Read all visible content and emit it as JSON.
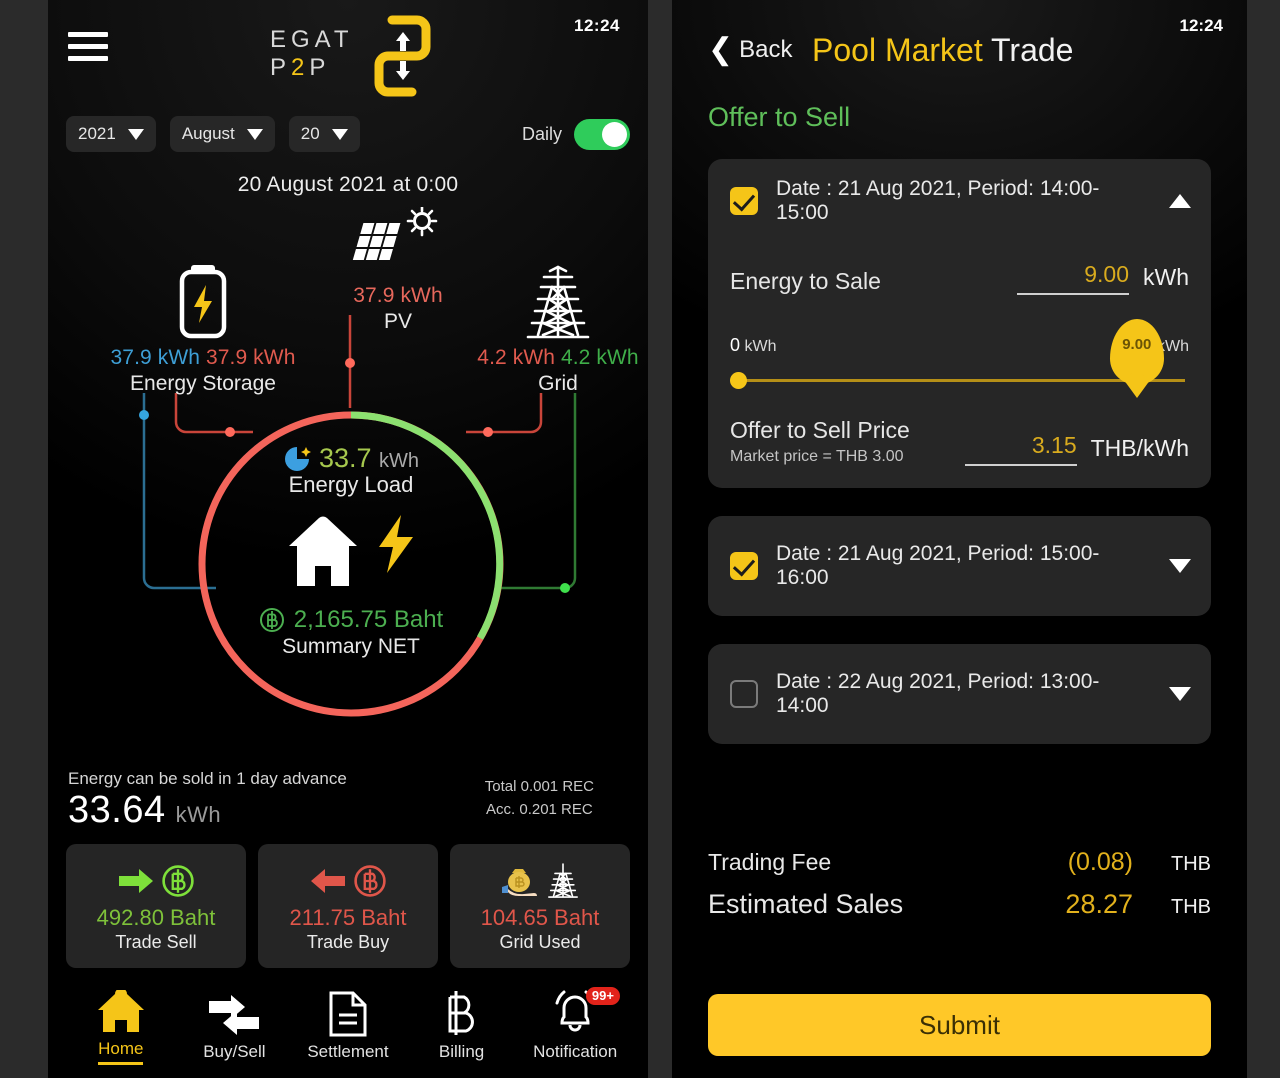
{
  "left": {
    "time": "12:24",
    "logo": {
      "line1": "EGAT",
      "p": "P",
      "two": "2",
      "p2": "P"
    },
    "selectors": [
      {
        "name": "year",
        "value": "2021"
      },
      {
        "name": "month",
        "value": "August"
      },
      {
        "name": "day",
        "value": "20"
      }
    ],
    "toggle": {
      "label": "Daily",
      "state": "on"
    },
    "date_line": "20 August 2021 at 0:00",
    "nodes": {
      "pv": {
        "value": "37.9 kWh",
        "label": "PV"
      },
      "storage": {
        "value_in": "37.9 kWh",
        "value_out": "37.9 kWh",
        "label": "Energy Storage"
      },
      "grid": {
        "value_in": "4.2 kWh",
        "value_out": "4.2 kWh",
        "label": "Grid"
      }
    },
    "center": {
      "load_value": "33.7",
      "load_unit": "kWh",
      "load_label": "Energy Load",
      "net_value": "2,165.75 Baht",
      "net_label": "Summary NET"
    },
    "sellable": {
      "caption": "Energy can be sold in 1 day advance",
      "value": "33.64",
      "unit": "kWh",
      "rec_total": "Total 0.001 REC",
      "rec_acc": "Acc. 0.201 REC"
    },
    "trade_cards": [
      {
        "name": "trade-sell",
        "amount": "492.80 Baht",
        "caption": "Trade Sell",
        "color": "#7ec13a"
      },
      {
        "name": "trade-buy",
        "amount": "211.75 Baht",
        "caption": "Trade Buy",
        "color": "#e0564a"
      },
      {
        "name": "grid-used",
        "amount": "104.65 Baht",
        "caption": "Grid Used",
        "color": "#e0564a"
      }
    ],
    "nav": [
      {
        "name": "home",
        "label": "Home",
        "active": true
      },
      {
        "name": "buy-sell",
        "label": "Buy/Sell",
        "active": false
      },
      {
        "name": "settlement",
        "label": "Settlement",
        "active": false
      },
      {
        "name": "billing",
        "label": "Billing",
        "active": false
      },
      {
        "name": "notification",
        "label": "Notification",
        "active": false,
        "badge": "99+"
      }
    ]
  },
  "right": {
    "time": "12:24",
    "back_label": "Back",
    "title_accent": "Pool Market",
    "title_rest": " Trade",
    "section_title": "Offer to Sell",
    "offers": [
      {
        "checked": true,
        "expanded": true,
        "title": "Date : 21 Aug 2021, Period: 14:00-15:00",
        "energy_label": "Energy to Sale",
        "energy_value": "9.00",
        "energy_unit": "kWh",
        "slider_min": "0",
        "slider_min_unit": "kWh",
        "slider_max": "10",
        "slider_max_unit": "kWh",
        "slider_value": "9.00",
        "slider_percent": 90,
        "price_label": "Offer to Sell Price",
        "price_sub": "Market price = THB 3.00",
        "price_value": "3.15",
        "price_unit": "THB/kWh"
      },
      {
        "checked": true,
        "expanded": false,
        "title": "Date : 21 Aug 2021, Period: 15:00-16:00"
      },
      {
        "checked": false,
        "expanded": false,
        "title": "Date : 22 Aug 2021, Period: 13:00-14:00"
      }
    ],
    "totals": [
      {
        "label": "Trading Fee",
        "value": "(0.08)",
        "currency": "THB"
      },
      {
        "label": "Estimated Sales",
        "value": "28.27",
        "currency": "THB"
      }
    ],
    "submit_label": "Submit"
  },
  "colors": {
    "accent_yellow": "#f5c518",
    "green": "#5fbf5a",
    "red": "#e0564a",
    "blue": "#3e9fd6"
  }
}
